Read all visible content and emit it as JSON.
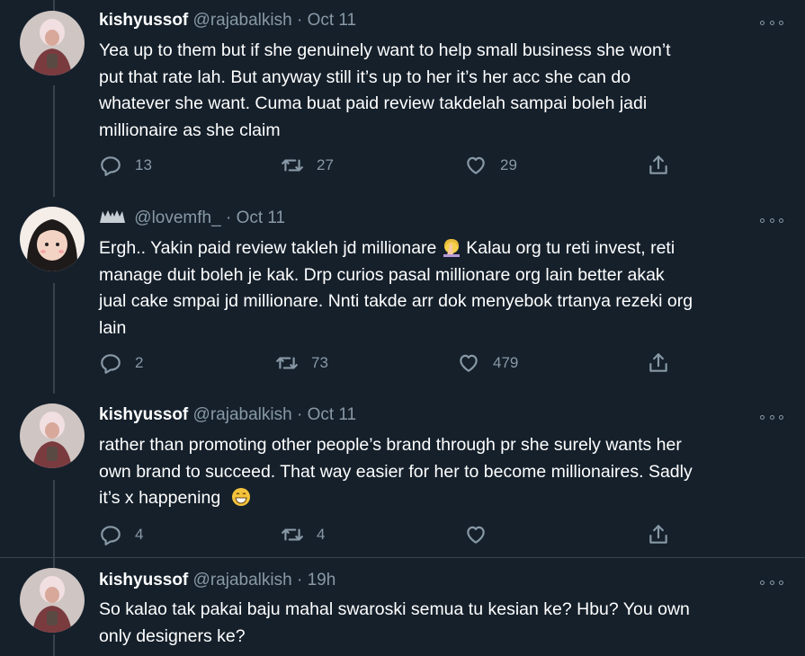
{
  "tweets": [
    {
      "name": "kishyussof",
      "handle": "@rajabalkish",
      "sep": "·",
      "time": "Oct 11",
      "lines": [
        "Yea up to them but if she genuinely want to help small business she won’t",
        "put that rate lah. But anyway still it’s up to her it’s her acc she can do",
        "whatever she want. Cuma buat paid review takdelah sampai boleh jadi",
        "millionaire as she claim"
      ],
      "replies": "13",
      "retweets": "27",
      "likes": "29"
    },
    {
      "name": "",
      "handle": "@lovemfh_",
      "sep": "·",
      "time": "Oct 11",
      "lines": [
        "Ergh.. Yakin paid review takleh jd millionare",
        "manage duit boleh je kak. Drp curios pasal millionare org lain better akak",
        "jual cake smpai jd millionare. Nnti takde arr dok menyebok trtanya rezeki org",
        "lain"
      ],
      "line1_rest": " Kalau org tu reti invest, reti",
      "replies": "2",
      "retweets": "73",
      "likes": "479"
    },
    {
      "name": "kishyussof",
      "handle": "@rajabalkish",
      "sep": "·",
      "time": "Oct 11",
      "lines": [
        "rather than promoting other people’s brand through pr she surely wants her",
        "own brand to succeed. That way easier for her to become millionaires. Sadly",
        "it’s x happening"
      ],
      "replies": "4",
      "retweets": "4",
      "likes": ""
    },
    {
      "name": "kishyussof",
      "handle": "@rajabalkish",
      "sep": "·",
      "time": "19h",
      "lines": [
        "So kalao tak pakai baju mahal swaroski semua tu kesian ke? Hbu? You own",
        "only designers ke?"
      ]
    }
  ],
  "icons": [
    "reply-icon",
    "retweet-icon",
    "like-icon",
    "share-icon",
    "more-icon"
  ],
  "colors": {
    "background": "#15202b",
    "muted": "#8899a6",
    "thread_line": "#38444d",
    "text": "#ffffff"
  }
}
